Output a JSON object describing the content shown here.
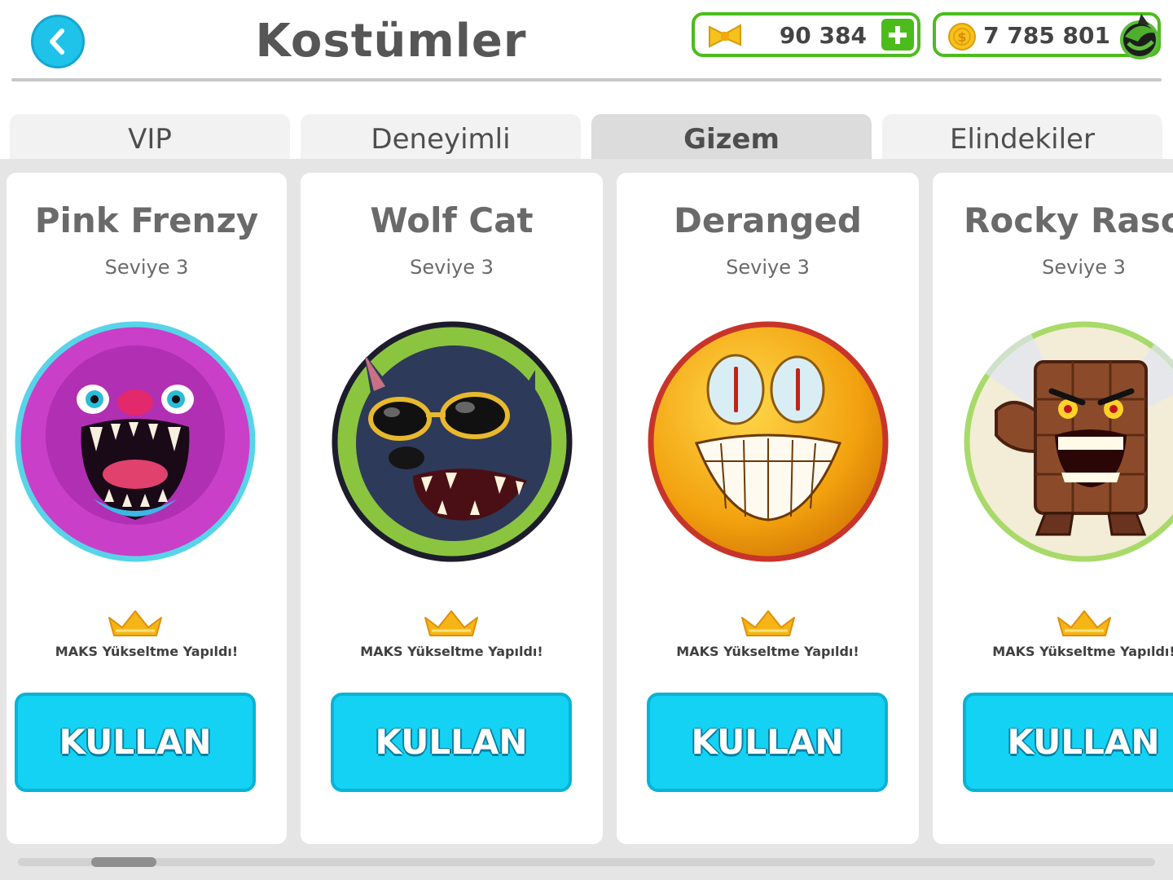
{
  "header": {
    "title": "Kostümler",
    "back_icon": "chevron-left-icon"
  },
  "currencies": {
    "tickets": {
      "amount": "90 384",
      "icon": "ticket-bow-icon",
      "action_icon": "plus-icon"
    },
    "coins": {
      "amount": "7 785 801",
      "icon": "coin-icon",
      "action_icon": "shark-badge-icon"
    }
  },
  "tabs": [
    {
      "label": "VIP",
      "active": false
    },
    {
      "label": "Deneyimli",
      "active": false
    },
    {
      "label": "Gizem",
      "active": true
    },
    {
      "label": "Elindekiler",
      "active": false
    }
  ],
  "costumes": [
    {
      "name": "Pink Frenzy",
      "level": "Seviye 3",
      "status": "MAKS Yükseltme Yapıldı!",
      "button": "KULLAN",
      "ring_color": "#58d4e8",
      "avatar": "pink-monster-avatar"
    },
    {
      "name": "Wolf Cat",
      "level": "Seviye 3",
      "status": "MAKS Yükseltme Yapıldı!",
      "button": "KULLAN",
      "ring_color": "#1c1c2c",
      "avatar": "wolf-cat-avatar"
    },
    {
      "name": "Deranged",
      "level": "Seviye 3",
      "status": "MAKS Yükseltme Yapıldı!",
      "button": "KULLAN",
      "ring_color": "#c8342a",
      "avatar": "deranged-avatar"
    },
    {
      "name": "Rocky Rasca",
      "level": "Seviye 3",
      "status": "MAKS Yükseltme Yapıldı!",
      "button": "KULLAN",
      "ring_color": "#a8da6a",
      "avatar": "rocky-rascal-avatar"
    }
  ],
  "colors": {
    "accent_blue": "#14d2f3",
    "accent_green": "#4cbc1c",
    "crown_gold": "#f5b516"
  }
}
